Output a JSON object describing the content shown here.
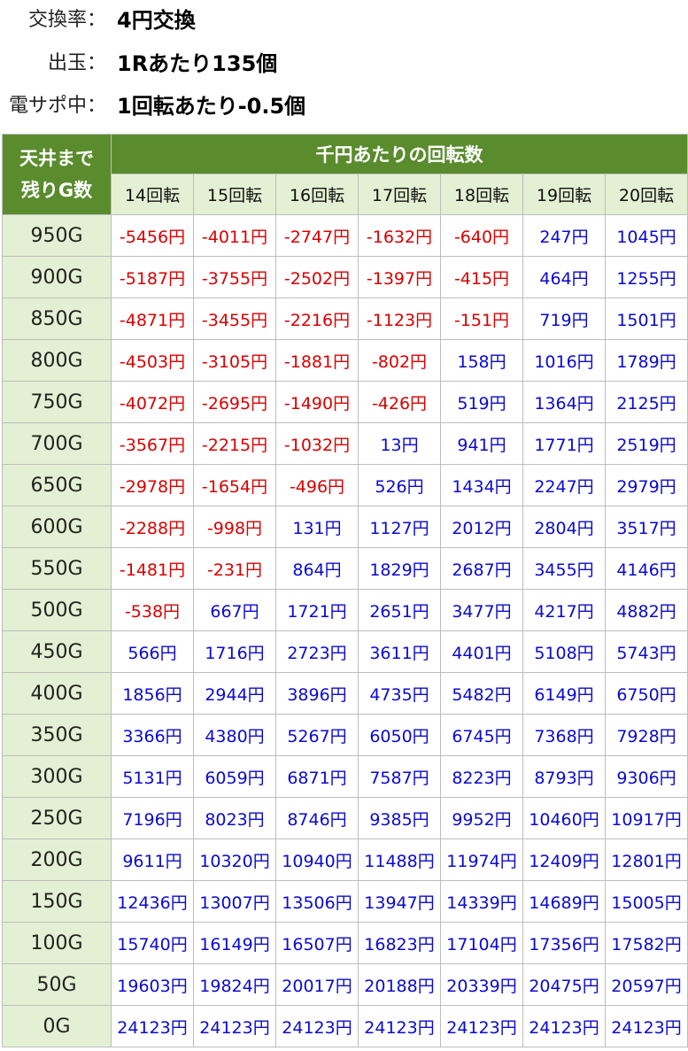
{
  "info": [
    {
      "label": "交換率：",
      "value": "4円交換"
    },
    {
      "label": "出玉：",
      "value": "1Rあたり135個"
    },
    {
      "label": "電サポ中：",
      "value": "1回転あたり-0.5個"
    }
  ],
  "table": {
    "corner_line1": "天井まで",
    "corner_line2": "残りG数",
    "group_header": "千円あたりの回転数",
    "columns": [
      "14回転",
      "15回転",
      "16回転",
      "17回転",
      "18回転",
      "19回転",
      "20回転"
    ],
    "colors": {
      "header_green": "#5a8c2e",
      "light_green": "#e4f0d3",
      "negative": "#d90000",
      "positive": "#0a0ad0"
    },
    "rows": [
      {
        "label": "950G",
        "values": [
          "-5456円",
          "-4011円",
          "-2747円",
          "-1632円",
          "-640円",
          "247円",
          "1045円"
        ]
      },
      {
        "label": "900G",
        "values": [
          "-5187円",
          "-3755円",
          "-2502円",
          "-1397円",
          "-415円",
          "464円",
          "1255円"
        ]
      },
      {
        "label": "850G",
        "values": [
          "-4871円",
          "-3455円",
          "-2216円",
          "-1123円",
          "-151円",
          "719円",
          "1501円"
        ]
      },
      {
        "label": "800G",
        "values": [
          "-4503円",
          "-3105円",
          "-1881円",
          "-802円",
          "158円",
          "1016円",
          "1789円"
        ]
      },
      {
        "label": "750G",
        "values": [
          "-4072円",
          "-2695円",
          "-1490円",
          "-426円",
          "519円",
          "1364円",
          "2125円"
        ]
      },
      {
        "label": "700G",
        "values": [
          "-3567円",
          "-2215円",
          "-1032円",
          "13円",
          "941円",
          "1771円",
          "2519円"
        ]
      },
      {
        "label": "650G",
        "values": [
          "-2978円",
          "-1654円",
          "-496円",
          "526円",
          "1434円",
          "2247円",
          "2979円"
        ]
      },
      {
        "label": "600G",
        "values": [
          "-2288円",
          "-998円",
          "131円",
          "1127円",
          "2012円",
          "2804円",
          "3517円"
        ]
      },
      {
        "label": "550G",
        "values": [
          "-1481円",
          "-231円",
          "864円",
          "1829円",
          "2687円",
          "3455円",
          "4146円"
        ]
      },
      {
        "label": "500G",
        "values": [
          "-538円",
          "667円",
          "1721円",
          "2651円",
          "3477円",
          "4217円",
          "4882円"
        ]
      },
      {
        "label": "450G",
        "values": [
          "566円",
          "1716円",
          "2723円",
          "3611円",
          "4401円",
          "5108円",
          "5743円"
        ]
      },
      {
        "label": "400G",
        "values": [
          "1856円",
          "2944円",
          "3896円",
          "4735円",
          "5482円",
          "6149円",
          "6750円"
        ]
      },
      {
        "label": "350G",
        "values": [
          "3366円",
          "4380円",
          "5267円",
          "6050円",
          "6745円",
          "7368円",
          "7928円"
        ]
      },
      {
        "label": "300G",
        "values": [
          "5131円",
          "6059円",
          "6871円",
          "7587円",
          "8223円",
          "8793円",
          "9306円"
        ]
      },
      {
        "label": "250G",
        "values": [
          "7196円",
          "8023円",
          "8746円",
          "9385円",
          "9952円",
          "10460円",
          "10917円"
        ]
      },
      {
        "label": "200G",
        "values": [
          "9611円",
          "10320円",
          "10940円",
          "11488円",
          "11974円",
          "12409円",
          "12801円"
        ]
      },
      {
        "label": "150G",
        "values": [
          "12436円",
          "13007円",
          "13506円",
          "13947円",
          "14339円",
          "14689円",
          "15005円"
        ]
      },
      {
        "label": "100G",
        "values": [
          "15740円",
          "16149円",
          "16507円",
          "16823円",
          "17104円",
          "17356円",
          "17582円"
        ]
      },
      {
        "label": "50G",
        "values": [
          "19603円",
          "19824円",
          "20017円",
          "20188円",
          "20339円",
          "20475円",
          "20597円"
        ]
      },
      {
        "label": "0G",
        "values": [
          "24123円",
          "24123円",
          "24123円",
          "24123円",
          "24123円",
          "24123円",
          "24123円"
        ]
      }
    ]
  }
}
